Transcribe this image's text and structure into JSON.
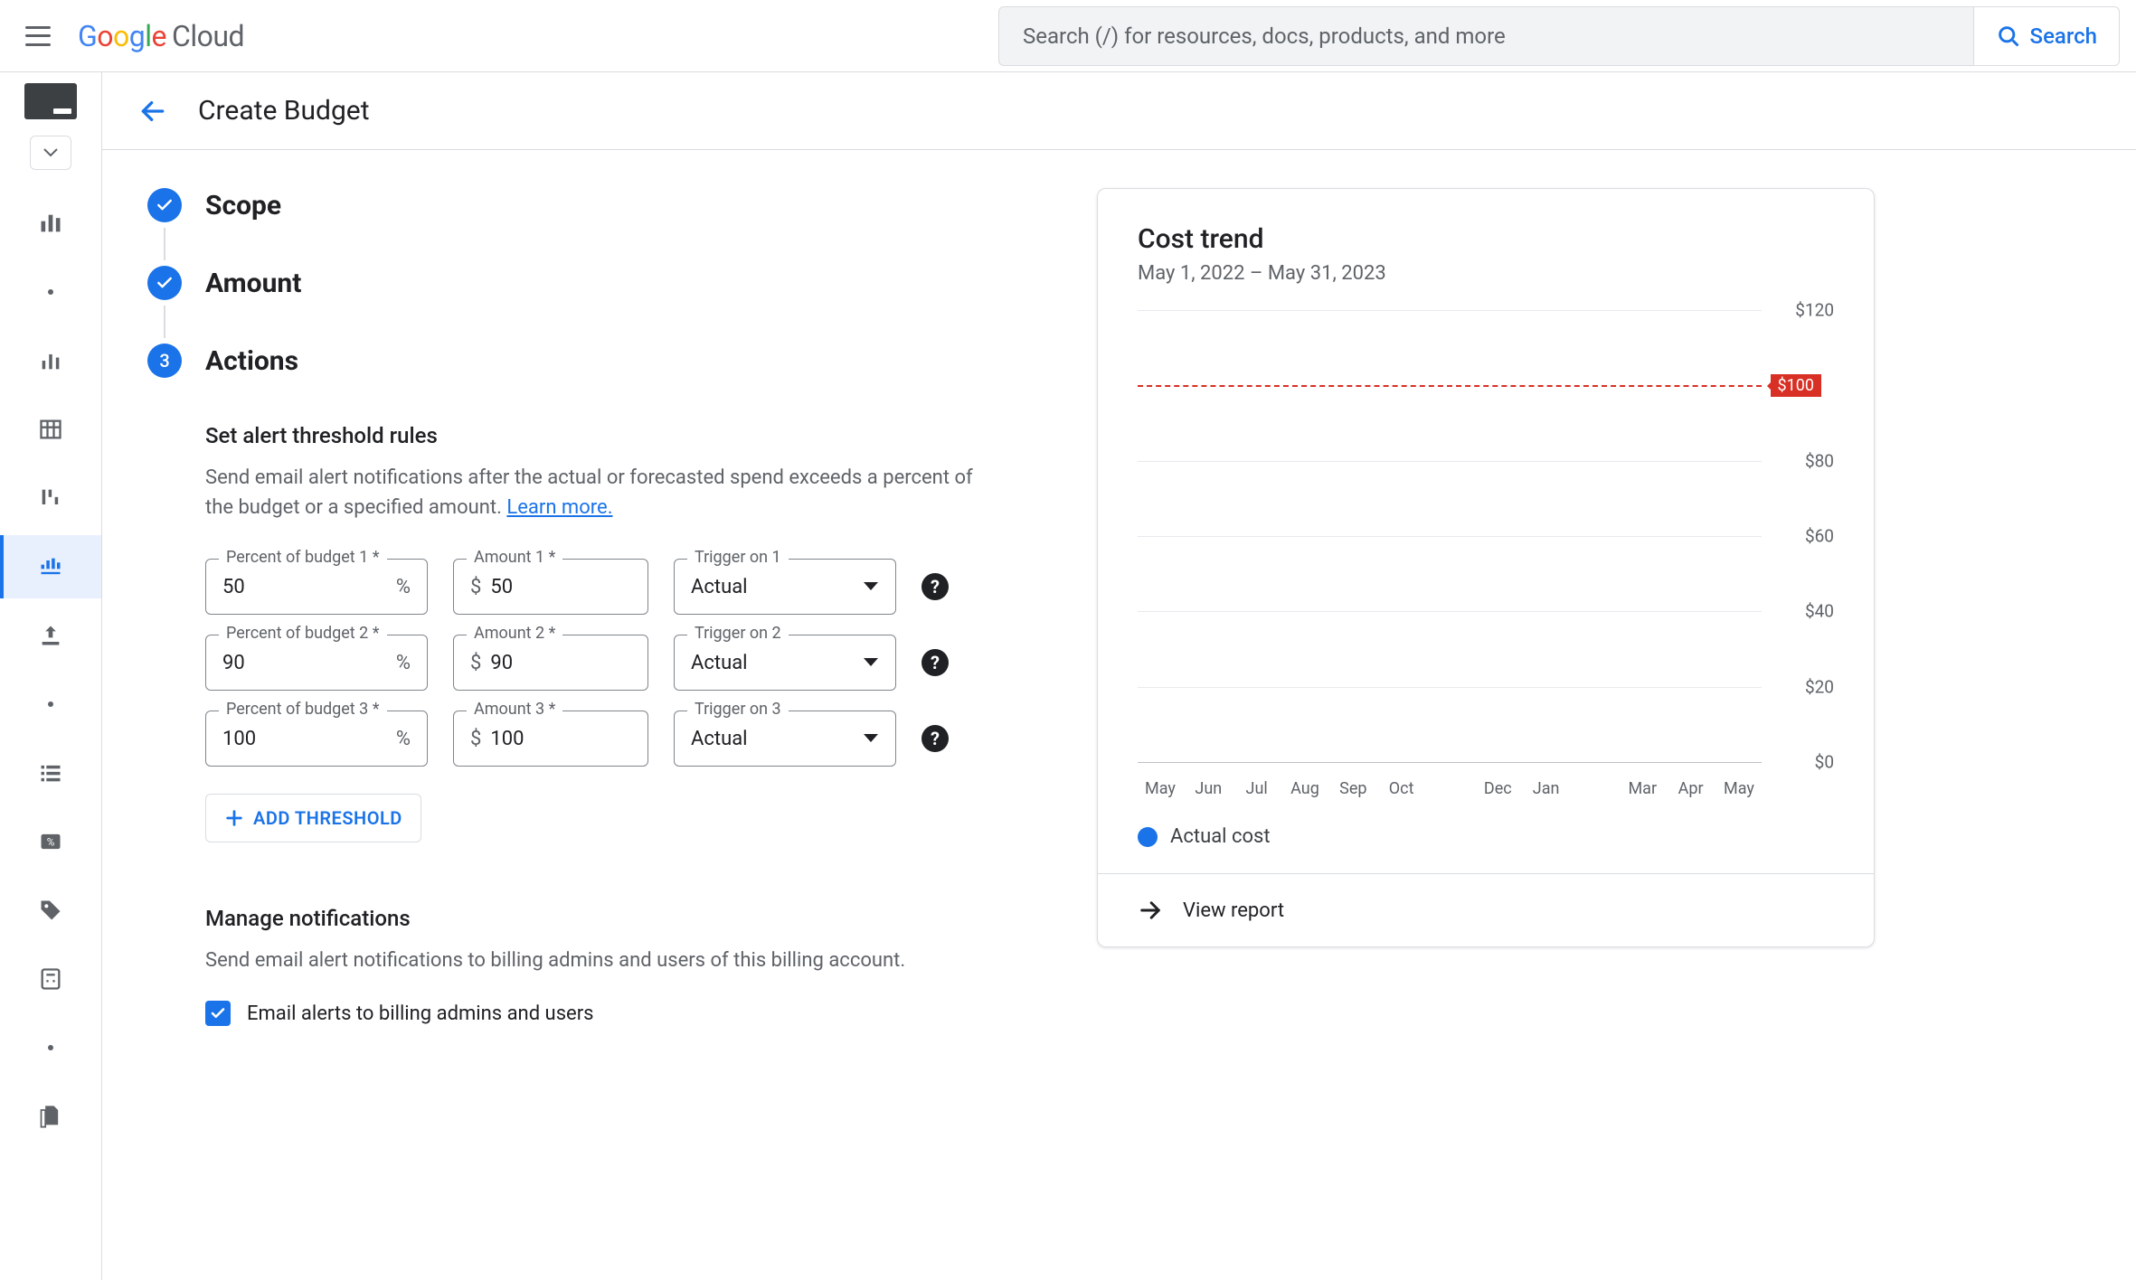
{
  "topbar": {
    "search_placeholder": "Search (/) for resources, docs, products, and more",
    "search_button": "Search",
    "logo_cloud": "Cloud"
  },
  "page": {
    "title": "Create Budget"
  },
  "stepper": {
    "steps": [
      "Scope",
      "Amount",
      "Actions"
    ],
    "current_index": 2,
    "current_num": "3"
  },
  "actions": {
    "heading": "Set alert threshold rules",
    "desc_a": "Send email alert notifications after the actual or forecasted spend exceeds a percent of the budget or a specified amount. ",
    "learn": "Learn more.",
    "labels": {
      "pct": "Percent of budget",
      "amt": "Amount",
      "trg": "Trigger on"
    },
    "rows": [
      {
        "pct": "50",
        "amt": "50",
        "trg": "Actual"
      },
      {
        "pct": "90",
        "amt": "90",
        "trg": "Actual"
      },
      {
        "pct": "100",
        "amt": "100",
        "trg": "Actual"
      }
    ],
    "add_label": "ADD THRESHOLD"
  },
  "notifications": {
    "heading": "Manage notifications",
    "desc": "Send email alert notifications to billing admins and users of this billing account.",
    "checkbox_label": "Email alerts to billing admins and users",
    "checked": true
  },
  "panel": {
    "title": "Cost trend",
    "subtitle": "May 1, 2022 – May 31, 2023",
    "legend": "Actual cost",
    "view_report": "View report"
  },
  "chart_data": {
    "type": "line",
    "title": "Cost trend",
    "xlabel": "",
    "ylabel": "",
    "ylim": [
      0,
      120
    ],
    "yticks": [
      0,
      20,
      40,
      60,
      80,
      120
    ],
    "threshold": {
      "value": 100,
      "label": "$100"
    },
    "categories": [
      "May",
      "Jun",
      "Jul",
      "Aug",
      "Sep",
      "Oct",
      "",
      "Dec",
      "Jan",
      "",
      "Mar",
      "Apr",
      "May"
    ],
    "series": [
      {
        "name": "Actual cost",
        "values": [
          0,
          0,
          0,
          0,
          0,
          0,
          0,
          0,
          0,
          0,
          0,
          0,
          0
        ]
      }
    ]
  }
}
